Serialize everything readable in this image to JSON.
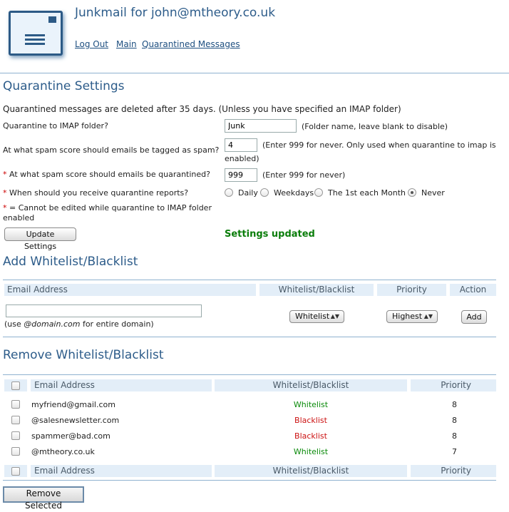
{
  "header": {
    "title": "Junkmail for john@mtheory.co.uk",
    "nav": [
      "Log Out",
      "Main",
      "Quarantined Messages"
    ]
  },
  "quarantine": {
    "title": "Quarantine Settings",
    "notice": "Quarantined messages are deleted after 35 days. (Unless you have specified an IMAP folder)",
    "imap_label": "Quarantine to IMAP folder?",
    "imap_value": "Junk",
    "imap_hint": "(Folder name, leave blank to disable)",
    "tag_label": "At what spam score should emails be tagged as spam?",
    "tag_value": "4",
    "tag_hint_1": "(Enter 999 for never. Only used when quarantine to imap is",
    "tag_hint_2": "enabled)",
    "quar_label": "At what spam score should emails be quarantined?",
    "quar_value": "999",
    "quar_hint": "(Enter 999 for never)",
    "report_label": "When should you receive quarantine reports?",
    "report_options": [
      "Daily",
      "Weekdays",
      "The 1st each Month",
      "Never"
    ],
    "report_selected": "Never",
    "star": "*",
    "footnote_1": "= Cannot be edited while quarantine to IMAP folder",
    "footnote_2": "enabled",
    "update_button": "Update Settings",
    "status": "Settings updated"
  },
  "add": {
    "title": "Add Whitelist/Blacklist",
    "headers": [
      "Email Address",
      "Whitelist/Blacklist",
      "Priority",
      "Action"
    ],
    "email_placeholder": "",
    "hint_prefix": "(use ",
    "hint_em": "@domain.com",
    "hint_suffix": " for entire domain)",
    "list_type": "Whitelist",
    "priority": "Highest",
    "add_button": "Add"
  },
  "remove": {
    "title": "Remove Whitelist/Blacklist",
    "headers": [
      "Email Address",
      "Whitelist/Blacklist",
      "Priority"
    ],
    "rows": [
      {
        "email": "myfriend@gmail.com",
        "type": "Whitelist",
        "priority": "8"
      },
      {
        "email": "@salesnewsletter.com",
        "type": "Blacklist",
        "priority": "8"
      },
      {
        "email": "spammer@bad.com",
        "type": "Blacklist",
        "priority": "8"
      },
      {
        "email": "@mtheory.co.uk",
        "type": "Whitelist",
        "priority": "7"
      }
    ],
    "remove_button": "Remove Selected"
  },
  "colors": {
    "heading": "#2d5c8a",
    "whitelist": "#0a8a0a",
    "blacklist": "#cc1111",
    "header_bg": "#e3eef8"
  }
}
